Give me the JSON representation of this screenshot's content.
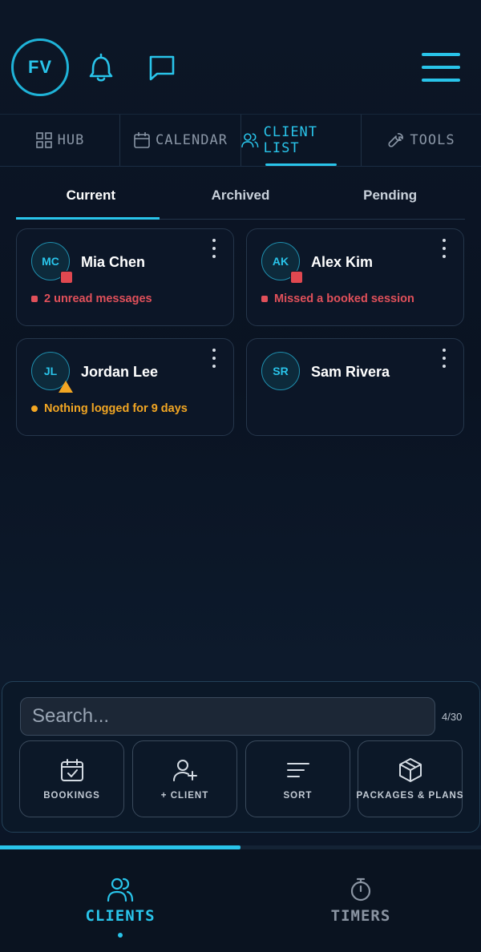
{
  "header": {
    "avatar_initials": "FV",
    "icons": [
      "bell-icon",
      "chat-icon",
      "menu-icon"
    ]
  },
  "top_tabs": [
    {
      "label": "HUB",
      "icon": "grid-icon",
      "active": false
    },
    {
      "label": "CALENDAR",
      "icon": "calendar-icon",
      "active": false
    },
    {
      "label": "CLIENT LIST",
      "icon": "users-icon",
      "active": true
    },
    {
      "label": "TOOLS",
      "icon": "wrench-icon",
      "active": false
    }
  ],
  "sub_tabs": [
    {
      "label": "Current",
      "active": true
    },
    {
      "label": "Archived",
      "active": false
    },
    {
      "label": "Pending",
      "active": false
    }
  ],
  "clients": [
    {
      "initials": "MC",
      "name": "Mia Chen",
      "badge": "red",
      "status": "2 unread messages",
      "status_color": "#e0505a"
    },
    {
      "initials": "AK",
      "name": "Alex Kim",
      "badge": "red",
      "status": "Missed a booked session",
      "status_color": "#e0505a"
    },
    {
      "initials": "JL",
      "name": "Jordan Lee",
      "badge": "warning",
      "status": "Nothing logged for 9 days",
      "status_color": "#f2a623"
    },
    {
      "initials": "SR",
      "name": "Sam Rivera",
      "badge": "",
      "status": "",
      "status_color": ""
    }
  ],
  "search": {
    "placeholder": "Search...",
    "value": "",
    "count": "4/30"
  },
  "actions": [
    {
      "label": "BOOKINGS",
      "icon": "calendar-check-icon"
    },
    {
      "label": "+ CLIENT",
      "icon": "add-user-icon"
    },
    {
      "label": "SORT",
      "icon": "sort-icon"
    },
    {
      "label": "PACKAGES & PLANS",
      "icon": "package-icon"
    }
  ],
  "progress": 0.5,
  "bottom_nav": [
    {
      "label": "CLIENTS",
      "icon": "users-icon",
      "active": true
    },
    {
      "label": "TIMERS",
      "icon": "stopwatch-icon",
      "active": false
    }
  ],
  "colors": {
    "accent": "#29c4ea",
    "danger": "#e0505a",
    "warning": "#f2a623",
    "background": "#0a1322"
  }
}
